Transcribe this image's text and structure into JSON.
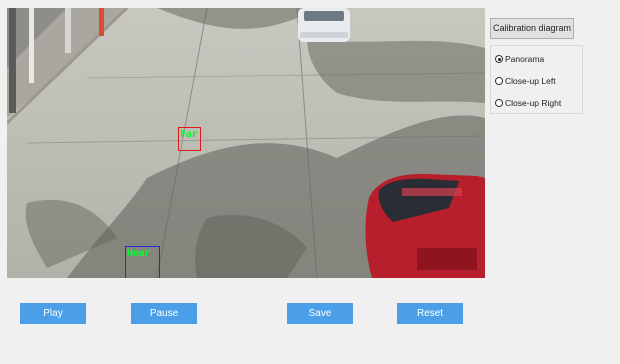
{
  "video": {
    "scene": "road-camera-view",
    "regions": [
      {
        "id": "far",
        "label": "Far",
        "color": "#e31a1a"
      },
      {
        "id": "near",
        "label": "Near",
        "color": "#1b2fd6"
      }
    ]
  },
  "sidebar": {
    "calibration_button": "Calibration diagram",
    "options": [
      {
        "label": "Panorama",
        "selected": true
      },
      {
        "label": "Close-up Left",
        "selected": false
      },
      {
        "label": "Close-up Right",
        "selected": false
      }
    ]
  },
  "controls": {
    "play": "Play",
    "pause": "Pause",
    "save": "Save",
    "reset": "Reset"
  },
  "colors": {
    "button_blue": "#4a9fe8",
    "label_green": "#00ff2a"
  }
}
